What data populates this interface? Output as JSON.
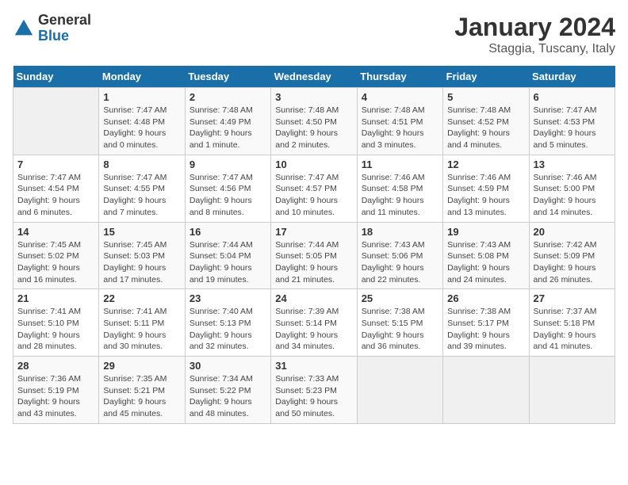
{
  "logo": {
    "general": "General",
    "blue": "Blue"
  },
  "title": "January 2024",
  "subtitle": "Staggia, Tuscany, Italy",
  "weekdays": [
    "Sunday",
    "Monday",
    "Tuesday",
    "Wednesday",
    "Thursday",
    "Friday",
    "Saturday"
  ],
  "weeks": [
    [
      {
        "day": "",
        "info": ""
      },
      {
        "day": "1",
        "info": "Sunrise: 7:47 AM\nSunset: 4:48 PM\nDaylight: 9 hours\nand 0 minutes."
      },
      {
        "day": "2",
        "info": "Sunrise: 7:48 AM\nSunset: 4:49 PM\nDaylight: 9 hours\nand 1 minute."
      },
      {
        "day": "3",
        "info": "Sunrise: 7:48 AM\nSunset: 4:50 PM\nDaylight: 9 hours\nand 2 minutes."
      },
      {
        "day": "4",
        "info": "Sunrise: 7:48 AM\nSunset: 4:51 PM\nDaylight: 9 hours\nand 3 minutes."
      },
      {
        "day": "5",
        "info": "Sunrise: 7:48 AM\nSunset: 4:52 PM\nDaylight: 9 hours\nand 4 minutes."
      },
      {
        "day": "6",
        "info": "Sunrise: 7:47 AM\nSunset: 4:53 PM\nDaylight: 9 hours\nand 5 minutes."
      }
    ],
    [
      {
        "day": "7",
        "info": "Sunrise: 7:47 AM\nSunset: 4:54 PM\nDaylight: 9 hours\nand 6 minutes."
      },
      {
        "day": "8",
        "info": "Sunrise: 7:47 AM\nSunset: 4:55 PM\nDaylight: 9 hours\nand 7 minutes."
      },
      {
        "day": "9",
        "info": "Sunrise: 7:47 AM\nSunset: 4:56 PM\nDaylight: 9 hours\nand 8 minutes."
      },
      {
        "day": "10",
        "info": "Sunrise: 7:47 AM\nSunset: 4:57 PM\nDaylight: 9 hours\nand 10 minutes."
      },
      {
        "day": "11",
        "info": "Sunrise: 7:46 AM\nSunset: 4:58 PM\nDaylight: 9 hours\nand 11 minutes."
      },
      {
        "day": "12",
        "info": "Sunrise: 7:46 AM\nSunset: 4:59 PM\nDaylight: 9 hours\nand 13 minutes."
      },
      {
        "day": "13",
        "info": "Sunrise: 7:46 AM\nSunset: 5:00 PM\nDaylight: 9 hours\nand 14 minutes."
      }
    ],
    [
      {
        "day": "14",
        "info": "Sunrise: 7:45 AM\nSunset: 5:02 PM\nDaylight: 9 hours\nand 16 minutes."
      },
      {
        "day": "15",
        "info": "Sunrise: 7:45 AM\nSunset: 5:03 PM\nDaylight: 9 hours\nand 17 minutes."
      },
      {
        "day": "16",
        "info": "Sunrise: 7:44 AM\nSunset: 5:04 PM\nDaylight: 9 hours\nand 19 minutes."
      },
      {
        "day": "17",
        "info": "Sunrise: 7:44 AM\nSunset: 5:05 PM\nDaylight: 9 hours\nand 21 minutes."
      },
      {
        "day": "18",
        "info": "Sunrise: 7:43 AM\nSunset: 5:06 PM\nDaylight: 9 hours\nand 22 minutes."
      },
      {
        "day": "19",
        "info": "Sunrise: 7:43 AM\nSunset: 5:08 PM\nDaylight: 9 hours\nand 24 minutes."
      },
      {
        "day": "20",
        "info": "Sunrise: 7:42 AM\nSunset: 5:09 PM\nDaylight: 9 hours\nand 26 minutes."
      }
    ],
    [
      {
        "day": "21",
        "info": "Sunrise: 7:41 AM\nSunset: 5:10 PM\nDaylight: 9 hours\nand 28 minutes."
      },
      {
        "day": "22",
        "info": "Sunrise: 7:41 AM\nSunset: 5:11 PM\nDaylight: 9 hours\nand 30 minutes."
      },
      {
        "day": "23",
        "info": "Sunrise: 7:40 AM\nSunset: 5:13 PM\nDaylight: 9 hours\nand 32 minutes."
      },
      {
        "day": "24",
        "info": "Sunrise: 7:39 AM\nSunset: 5:14 PM\nDaylight: 9 hours\nand 34 minutes."
      },
      {
        "day": "25",
        "info": "Sunrise: 7:38 AM\nSunset: 5:15 PM\nDaylight: 9 hours\nand 36 minutes."
      },
      {
        "day": "26",
        "info": "Sunrise: 7:38 AM\nSunset: 5:17 PM\nDaylight: 9 hours\nand 39 minutes."
      },
      {
        "day": "27",
        "info": "Sunrise: 7:37 AM\nSunset: 5:18 PM\nDaylight: 9 hours\nand 41 minutes."
      }
    ],
    [
      {
        "day": "28",
        "info": "Sunrise: 7:36 AM\nSunset: 5:19 PM\nDaylight: 9 hours\nand 43 minutes."
      },
      {
        "day": "29",
        "info": "Sunrise: 7:35 AM\nSunset: 5:21 PM\nDaylight: 9 hours\nand 45 minutes."
      },
      {
        "day": "30",
        "info": "Sunrise: 7:34 AM\nSunset: 5:22 PM\nDaylight: 9 hours\nand 48 minutes."
      },
      {
        "day": "31",
        "info": "Sunrise: 7:33 AM\nSunset: 5:23 PM\nDaylight: 9 hours\nand 50 minutes."
      },
      {
        "day": "",
        "info": ""
      },
      {
        "day": "",
        "info": ""
      },
      {
        "day": "",
        "info": ""
      }
    ]
  ],
  "colors": {
    "header_bg": "#1a6fa8",
    "header_text": "#ffffff",
    "odd_row": "#f9f9f9",
    "even_row": "#ffffff",
    "empty_cell": "#f0f0f0"
  }
}
